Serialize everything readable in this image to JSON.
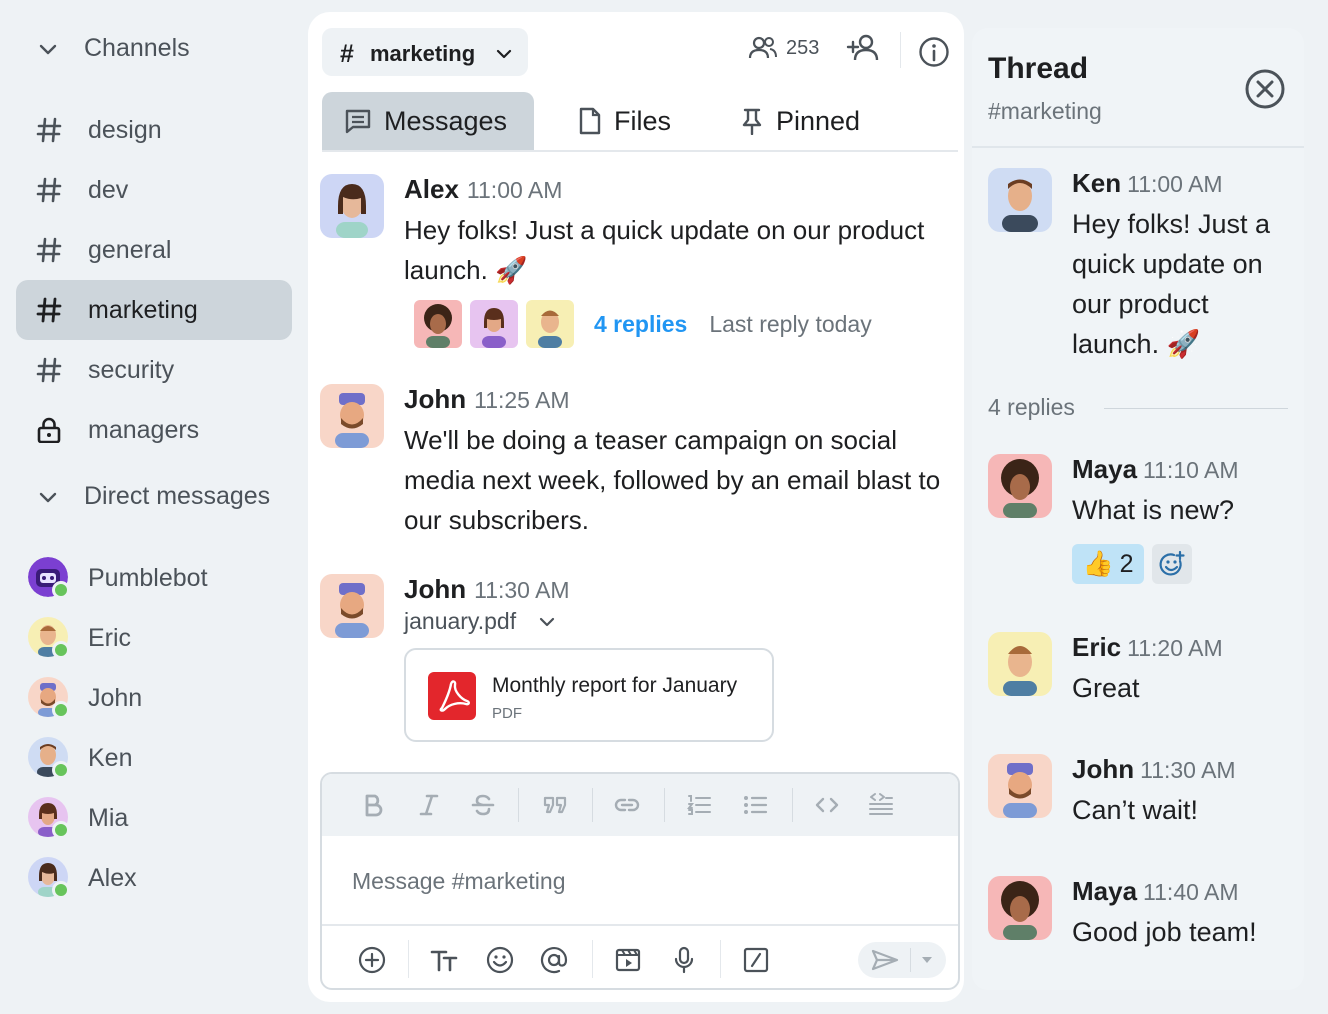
{
  "sidebar": {
    "channels_header": "Channels",
    "channels": [
      {
        "label": "design",
        "icon": "hash-icon"
      },
      {
        "label": "dev",
        "icon": "hash-icon"
      },
      {
        "label": "general",
        "icon": "hash-icon"
      },
      {
        "label": "marketing",
        "icon": "hash-icon",
        "active": true
      },
      {
        "label": "security",
        "icon": "hash-icon"
      },
      {
        "label": "managers",
        "icon": "lock-icon"
      }
    ],
    "dm_header": "Direct messages",
    "direct_messages": [
      {
        "label": "Pumblebot",
        "status": "online"
      },
      {
        "label": "Eric",
        "status": "online"
      },
      {
        "label": "John",
        "status": "online"
      },
      {
        "label": "Ken",
        "status": "online"
      },
      {
        "label": "Mia",
        "status": "online"
      },
      {
        "label": "Alex",
        "status": "online"
      }
    ]
  },
  "channel_header": {
    "hash": "#",
    "name": "marketing",
    "member_count": "253"
  },
  "tabs": [
    {
      "label": "Messages",
      "active": true
    },
    {
      "label": "Files"
    },
    {
      "label": "Pinned"
    }
  ],
  "messages": [
    {
      "author": "Alex",
      "time": "11:00 AM",
      "text": "Hey folks! Just a quick update on our product launch. 🚀",
      "replies": {
        "count_label": "4 replies",
        "last_label": "Last reply today"
      }
    },
    {
      "author": "John",
      "time": "11:25 AM",
      "text": "We'll be doing a teaser campaign on social media next week, followed by an email blast to our subscribers."
    },
    {
      "author": "John",
      "time": "11:30 AM",
      "attachment_name": "january.pdf",
      "attachment": {
        "title": "Monthly report for January",
        "type": "PDF"
      }
    }
  ],
  "composer": {
    "placeholder": "Message #marketing"
  },
  "thread": {
    "title": "Thread",
    "channel": "#marketing",
    "parent": {
      "author": "Ken",
      "time": "11:00 AM",
      "text": "Hey folks! Just a quick update on our product launch. 🚀"
    },
    "replies_label": "4 replies",
    "replies": [
      {
        "author": "Maya",
        "time": "11:10 AM",
        "text": "What is new?",
        "reaction": {
          "emoji": "👍",
          "count": "2"
        }
      },
      {
        "author": "Eric",
        "time": "11:20 AM",
        "text": "Great"
      },
      {
        "author": "John",
        "time": "11:30 AM",
        "text": "Can’t wait!"
      },
      {
        "author": "Maya",
        "time": "11:40 AM",
        "text": "Good job team!"
      }
    ]
  },
  "colors": {
    "accent": "#2196f3",
    "online": "#67c45b",
    "active_bg": "#cdd5db",
    "pdf_red": "#e3262c"
  }
}
